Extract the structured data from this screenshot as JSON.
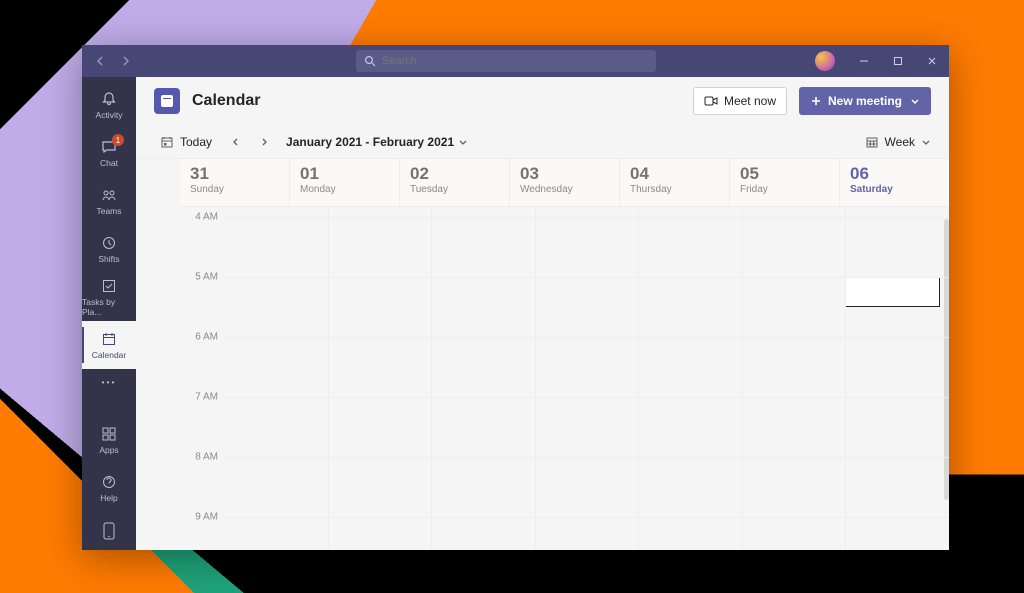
{
  "titlebar": {
    "search_placeholder": "Search"
  },
  "rail": {
    "items": [
      {
        "label": "Activity"
      },
      {
        "label": "Chat",
        "badge": "1"
      },
      {
        "label": "Teams"
      },
      {
        "label": "Shifts"
      },
      {
        "label": "Tasks by Pla..."
      },
      {
        "label": "Calendar"
      }
    ],
    "apps_label": "Apps",
    "help_label": "Help"
  },
  "header": {
    "title": "Calendar",
    "meet_now": "Meet now",
    "new_meeting": "New meeting"
  },
  "subbar": {
    "today": "Today",
    "range": "January 2021 - February 2021",
    "view": "Week"
  },
  "days": [
    {
      "num": "31",
      "name": "Sunday"
    },
    {
      "num": "01",
      "name": "Monday"
    },
    {
      "num": "02",
      "name": "Tuesday"
    },
    {
      "num": "03",
      "name": "Wednesday"
    },
    {
      "num": "04",
      "name": "Thursday"
    },
    {
      "num": "05",
      "name": "Friday"
    },
    {
      "num": "06",
      "name": "Saturday",
      "today": true
    }
  ],
  "hours": [
    "4 AM",
    "5 AM",
    "6 AM",
    "7 AM",
    "8 AM",
    "9 AM"
  ]
}
